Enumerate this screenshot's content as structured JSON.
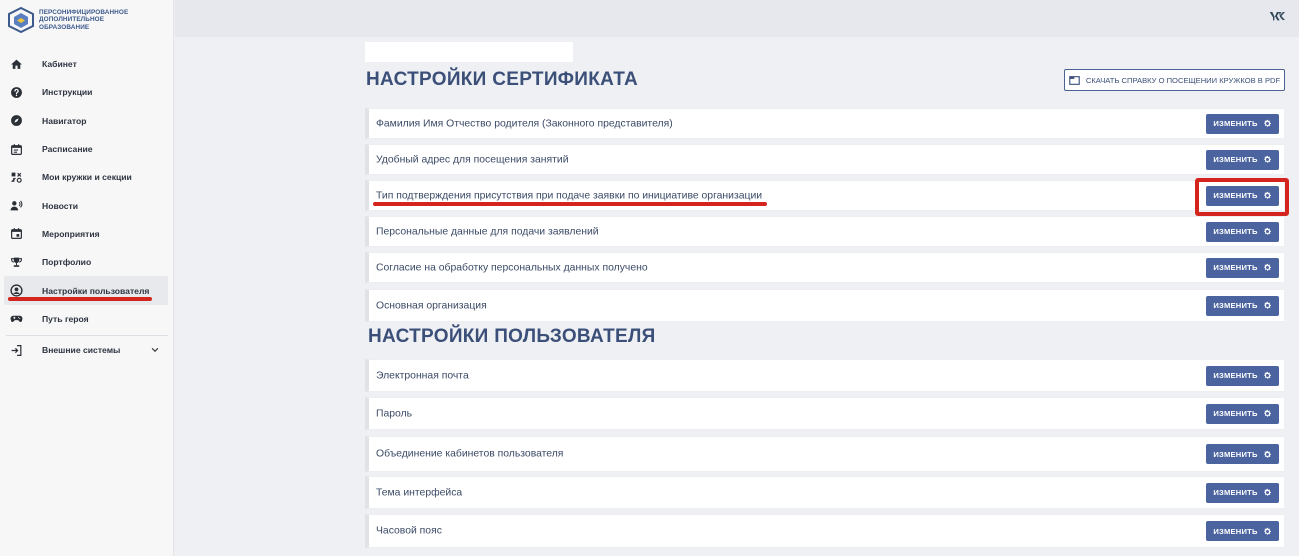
{
  "logo": {
    "line1": "ПЕРСОНИФИЦИРОВАННОЕ",
    "line2": "ДОПОЛНИТЕЛЬНОЕ",
    "line3": "ОБРАЗОВАНИЕ"
  },
  "sidebar": {
    "items": [
      {
        "label": "Кабинет",
        "icon": "home-icon"
      },
      {
        "label": "Инструкции",
        "icon": "question-icon"
      },
      {
        "label": "Навигатор",
        "icon": "compass-icon"
      },
      {
        "label": "Расписание",
        "icon": "calendar-icon"
      },
      {
        "label": "Мои кружки и секции",
        "icon": "puzzle-icon"
      },
      {
        "label": "Новости",
        "icon": "speaker-icon"
      },
      {
        "label": "Мероприятия",
        "icon": "event-icon"
      },
      {
        "label": "Портфолио",
        "icon": "trophy-icon"
      },
      {
        "label": "Настройки пользователя",
        "icon": "user-circle-icon",
        "active": true
      },
      {
        "label": "Путь героя",
        "icon": "gamepad-icon"
      },
      {
        "label": "Внешние системы",
        "icon": "login-icon",
        "expandable": true
      }
    ]
  },
  "cert": {
    "title": "НАСТРОЙКИ СЕРТИФИКАТА",
    "pdf_button": "СКАЧАТЬ СПРАВКУ О ПОСЕЩЕНИИ КРУЖКОВ В PDF",
    "rows": [
      "Фамилия Имя Отчество родителя (Законного представителя)",
      "Удобный адрес для посещения занятий",
      "Тип подтверждения присутствия при подаче заявки по инициативе организации",
      "Персональные данные для подачи заявлений",
      "Согласие на обработку персональных данных получено",
      "Основная организация"
    ]
  },
  "user": {
    "title": "НАСТРОЙКИ ПОЛЬЗОВАТЕЛЯ",
    "rows": [
      "Электронная почта",
      "Пароль",
      "Объединение кабинетов пользователя",
      "Тема интерфейса",
      "Часовой пояс"
    ]
  },
  "edit_label": "ИЗМЕНИТЬ",
  "colors": {
    "accent": "#4b64a0",
    "title": "#3b4f79",
    "annotation": "#d4241e"
  }
}
